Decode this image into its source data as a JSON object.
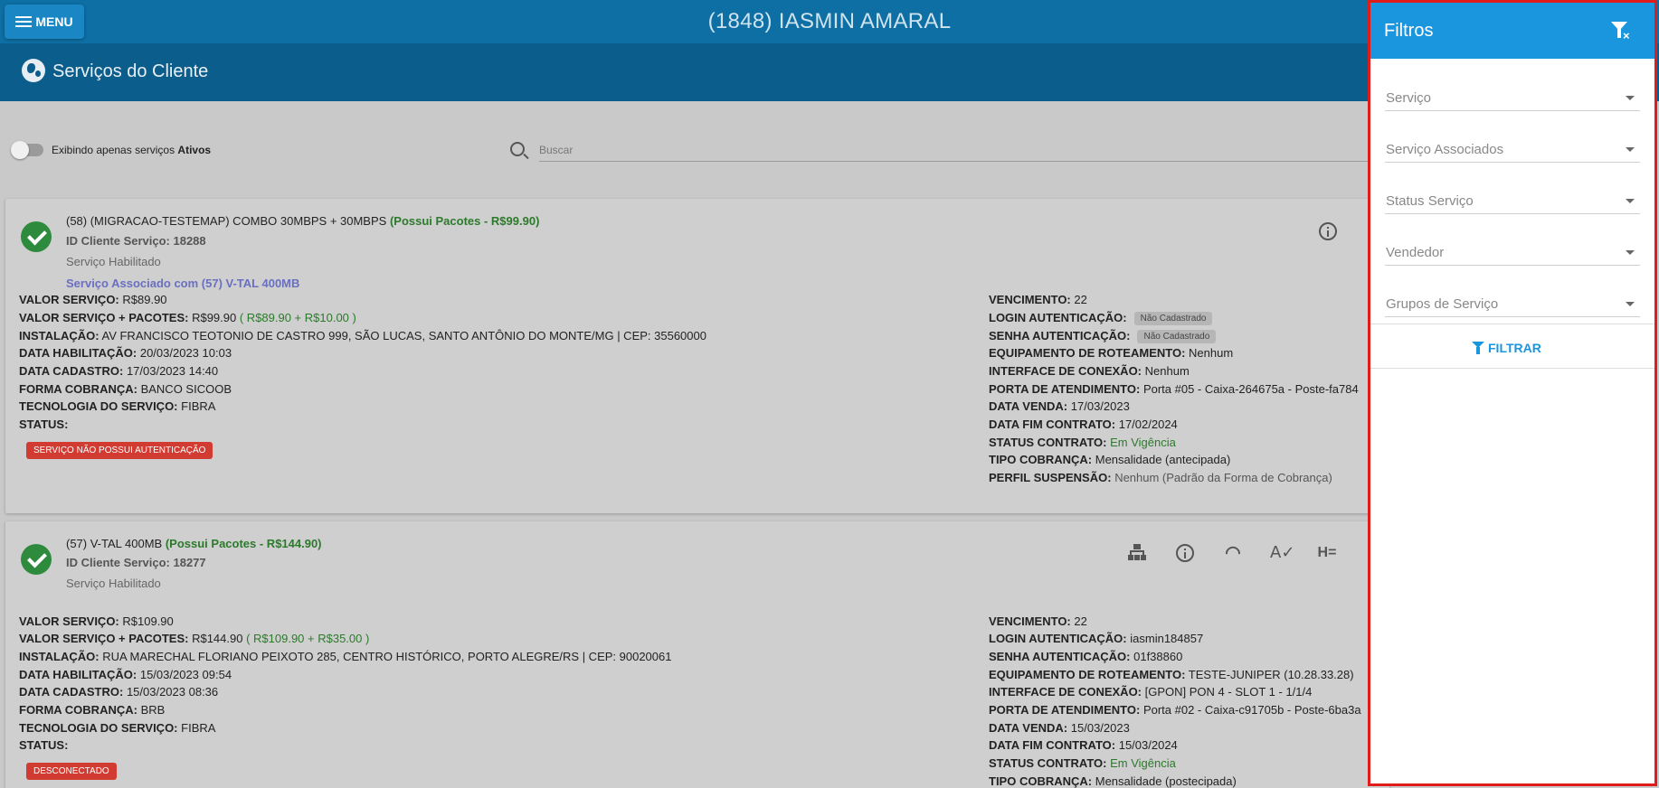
{
  "topbar": {
    "menu_label": "MENU",
    "title": "(1848) IASMIN AMARAL"
  },
  "header": {
    "title": "Serviços do Cliente"
  },
  "toolbar": {
    "toggle_text": "Exibindo apenas serviços ",
    "toggle_bold": "Ativos",
    "search_placeholder": "Buscar"
  },
  "services": [
    {
      "title": "(58) (MIGRACAO-TESTEMAP) COMBO 30MBPS + 30MBPS ",
      "package": "(Possui Pacotes - R$99.90)",
      "id_line": "ID Cliente Serviço: 18288",
      "status_line": "Serviço Habilitado",
      "assoc_line": "Serviço Associado com (57) V-TAL 400MB",
      "left": {
        "valor_servico": "R$89.90",
        "valor_pacotes": "R$99.90",
        "valor_pacotes_detail": "( R$89.90 + R$10.00 )",
        "instalacao": "AV FRANCISCO TEOTONIO DE CASTRO 999, SÃO LUCAS, SANTO ANTÔNIO DO MONTE/MG | CEP: 35560000",
        "data_habilitacao": "20/03/2023 10:03",
        "data_cadastro": "17/03/2023 14:40",
        "forma_cobranca": "BANCO SICOOB",
        "tecnologia": "FIBRA",
        "badge": "SERVIÇO NÃO POSSUI AUTENTICAÇÃO"
      },
      "right": {
        "vencimento": "22",
        "login": "Não Cadastrado",
        "senha": "Não Cadastrado",
        "equipamento": "Nenhum",
        "interface": "Nenhum",
        "porta": "Porta #05 - Caixa-264675a - Poste-fa784",
        "data_venda": "17/03/2023",
        "data_fim": "17/02/2024",
        "status_contrato": "Em Vigência",
        "tipo_cobranca": "Mensalidade (antecipada)",
        "perfil_suspensao": "Nenhum (Padrão da Forma de Cobrança)"
      }
    },
    {
      "title": "(57) V-TAL 400MB ",
      "package": "(Possui Pacotes - R$144.90)",
      "id_line": "ID Cliente Serviço: 18277",
      "status_line": "Serviço Habilitado",
      "left": {
        "valor_servico": "R$109.90",
        "valor_pacotes": "R$144.90",
        "valor_pacotes_detail": "( R$109.90 + R$35.00 )",
        "instalacao": "RUA MARECHAL FLORIANO PEIXOTO 285, CENTRO HISTÓRICO, PORTO ALEGRE/RS | CEP: 90020061",
        "data_habilitacao": "15/03/2023 09:54",
        "data_cadastro": "15/03/2023 08:36",
        "forma_cobranca": "BRB",
        "tecnologia": "FIBRA",
        "badge": "DESCONECTADO"
      },
      "right": {
        "vencimento": "22",
        "login": "iasmin184857",
        "senha": "01f38860",
        "equipamento": "TESTE-JUNIPER (10.28.33.28)",
        "interface": "[GPON] PON 4 - SLOT 1 - 1/1/4",
        "porta": "Porta #02 - Caixa-c91705b - Poste-6ba3a",
        "data_venda": "15/03/2023",
        "data_fim": "15/03/2024",
        "status_contrato": "Em Vigência",
        "tipo_cobranca": "Mensalidade (postecipada)"
      }
    }
  ],
  "labels": {
    "valor_servico": "VALOR SERVIÇO:",
    "valor_pacotes": "VALOR SERVIÇO + PACOTES:",
    "instalacao": "INSTALAÇÃO:",
    "data_habilitacao": "DATA HABILITAÇÃO:",
    "data_cadastro": "DATA CADASTRO:",
    "forma_cobranca": "FORMA COBRANÇA:",
    "tecnologia": "TECNOLOGIA DO SERVIÇO:",
    "status": "STATUS:",
    "vencimento": "VENCIMENTO:",
    "login": "LOGIN AUTENTICAÇÃO:",
    "senha": "SENHA AUTENTICAÇÃO:",
    "equipamento": "EQUIPAMENTO DE ROTEAMENTO:",
    "interface": "INTERFACE DE CONEXÃO:",
    "porta": "PORTA DE ATENDIMENTO:",
    "data_venda": "DATA VENDA:",
    "data_fim": "DATA FIM CONTRATO:",
    "status_contrato": "STATUS CONTRATO:",
    "tipo_cobranca": "TIPO COBRANÇA:",
    "perfil_suspensao": "PERFIL SUSPENSÃO:"
  },
  "filters": {
    "title": "Filtros",
    "fields": [
      "Serviço",
      "Serviço Associados",
      "Status Serviço",
      "Vendedor",
      "Grupos de Serviço"
    ],
    "button": "FILTRAR"
  },
  "colors": {
    "topbar": "#0d6fa3",
    "header": "#0b5d8c",
    "panel_head": "#1a96df",
    "highlight_border": "#e11a1a",
    "ok_green": "#2e8b3e",
    "badge_red": "#d23b32"
  }
}
